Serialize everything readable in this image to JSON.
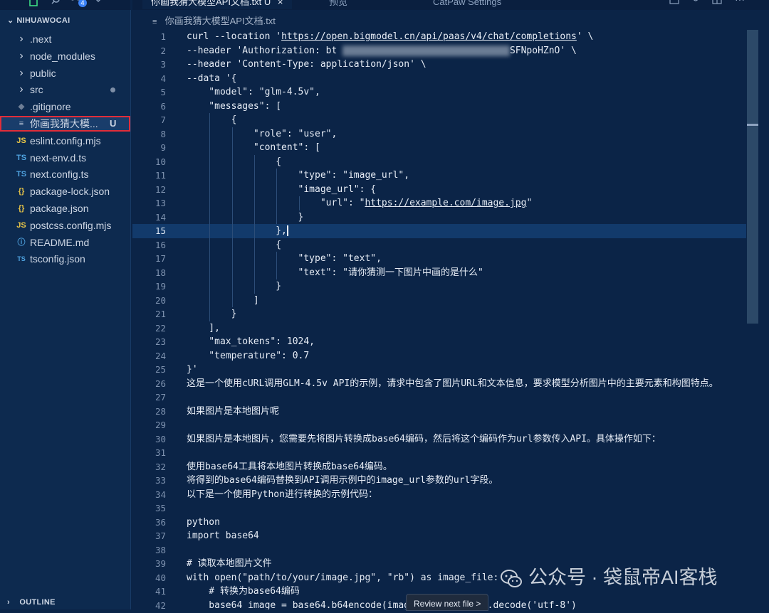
{
  "activity_bar": {
    "badge_count": "4"
  },
  "tabs": [
    {
      "label": "你画我猜大模型API文档.txt U",
      "active": true
    },
    {
      "label": "预览",
      "active": false
    },
    {
      "label": "CatPaw Settings",
      "active": false
    }
  ],
  "explorer": {
    "title": "NIHUAWOCAI",
    "items": [
      {
        "label": ".next",
        "icon": "chevron-right-icon",
        "glyph": "›"
      },
      {
        "label": "node_modules",
        "icon": "chevron-right-icon",
        "glyph": "›"
      },
      {
        "label": "public",
        "icon": "chevron-right-icon",
        "glyph": "›"
      },
      {
        "label": "src",
        "icon": "chevron-right-icon",
        "glyph": "›",
        "modified_dot": true
      },
      {
        "label": ".gitignore",
        "icon": "diamond-icon",
        "glyph": "◆"
      },
      {
        "label": "你画我猜大模...",
        "icon": "text-file-icon",
        "glyph": "≡",
        "status": "U",
        "selected": true
      },
      {
        "label": "eslint.config.mjs",
        "icon": "js-file-icon",
        "glyph": "JS"
      },
      {
        "label": "next-env.d.ts",
        "icon": "ts-file-icon",
        "glyph": "TS"
      },
      {
        "label": "next.config.ts",
        "icon": "ts-file-icon",
        "glyph": "TS"
      },
      {
        "label": "package-lock.json",
        "icon": "json-file-icon",
        "glyph": "{}"
      },
      {
        "label": "package.json",
        "icon": "json-file-icon",
        "glyph": "{}"
      },
      {
        "label": "postcss.config.mjs",
        "icon": "js-file-icon",
        "glyph": "JS"
      },
      {
        "label": "README.md",
        "icon": "info-icon",
        "glyph": "ⓘ"
      },
      {
        "label": "tsconfig.json",
        "icon": "tsconfig-file-icon",
        "glyph": "TS"
      }
    ],
    "outline_title": "OUTLINE"
  },
  "breadcrumb": "你画我猜大模型API文档.txt",
  "editor": {
    "current_line": 15,
    "lines": [
      {
        "n": "1",
        "text": "curl --location 'https://open.bigmodel.cn/api/paas/v4/chat/completions' \\"
      },
      {
        "n": "2",
        "text": "--header 'Authorization: bt                               SFNpoHZnO' \\"
      },
      {
        "n": "3",
        "text": "--header 'Content-Type: application/json' \\"
      },
      {
        "n": "4",
        "text": "--data '{"
      },
      {
        "n": "5",
        "text": "    \"model\": \"glm-4.5v\","
      },
      {
        "n": "6",
        "text": "    \"messages\": ["
      },
      {
        "n": "7",
        "text": "        {"
      },
      {
        "n": "8",
        "text": "            \"role\": \"user\","
      },
      {
        "n": "9",
        "text": "            \"content\": ["
      },
      {
        "n": "10",
        "text": "                {"
      },
      {
        "n": "11",
        "text": "                    \"type\": \"image_url\","
      },
      {
        "n": "12",
        "text": "                    \"image_url\": {"
      },
      {
        "n": "13",
        "text": "                        \"url\": \"https://example.com/image.jpg\""
      },
      {
        "n": "14",
        "text": "                    }"
      },
      {
        "n": "15",
        "text": "                },"
      },
      {
        "n": "16",
        "text": "                {"
      },
      {
        "n": "17",
        "text": "                    \"type\": \"text\","
      },
      {
        "n": "18",
        "text": "                    \"text\": \"请你猜测一下图片中画的是什么\""
      },
      {
        "n": "19",
        "text": "                }"
      },
      {
        "n": "20",
        "text": "            ]"
      },
      {
        "n": "21",
        "text": "        }"
      },
      {
        "n": "22",
        "text": "    ],"
      },
      {
        "n": "23",
        "text": "    \"max_tokens\": 1024,"
      },
      {
        "n": "24",
        "text": "    \"temperature\": 0.7"
      },
      {
        "n": "25",
        "text": "}'"
      },
      {
        "n": "26",
        "text": "这是一个使用cURL调用GLM-4.5v API的示例，请求中包含了图片URL和文本信息，要求模型分析图片中的主要元素和构图特点。"
      },
      {
        "n": "27",
        "text": ""
      },
      {
        "n": "28",
        "text": "如果图片是本地图片呢"
      },
      {
        "n": "29",
        "text": ""
      },
      {
        "n": "30",
        "text": "如果图片是本地图片，您需要先将图片转换成base64编码，然后将这个编码作为url参数传入API。具体操作如下："
      },
      {
        "n": "31",
        "text": ""
      },
      {
        "n": "32",
        "text": "使用base64工具将本地图片转换成base64编码。"
      },
      {
        "n": "33",
        "text": "将得到的base64编码替换到API调用示例中的image_url参数的url字段。"
      },
      {
        "n": "34",
        "text": "以下是一个使用Python进行转换的示例代码："
      },
      {
        "n": "35",
        "text": ""
      },
      {
        "n": "36",
        "text": "python"
      },
      {
        "n": "37",
        "text": "import base64"
      },
      {
        "n": "38",
        "text": ""
      },
      {
        "n": "39",
        "text": "# 读取本地图片文件"
      },
      {
        "n": "40",
        "text": "with open(\"path/to/your/image.jpg\", \"rb\") as image_file:"
      },
      {
        "n": "41",
        "text": "    # 转换为base64编码"
      },
      {
        "n": "42",
        "text": "    base64_image = base64.b64encode(image_file.read()).decode('utf-8')"
      }
    ]
  },
  "review_button": "Review next file >",
  "watermark": "公众号 · 袋鼠帝AI客栈"
}
